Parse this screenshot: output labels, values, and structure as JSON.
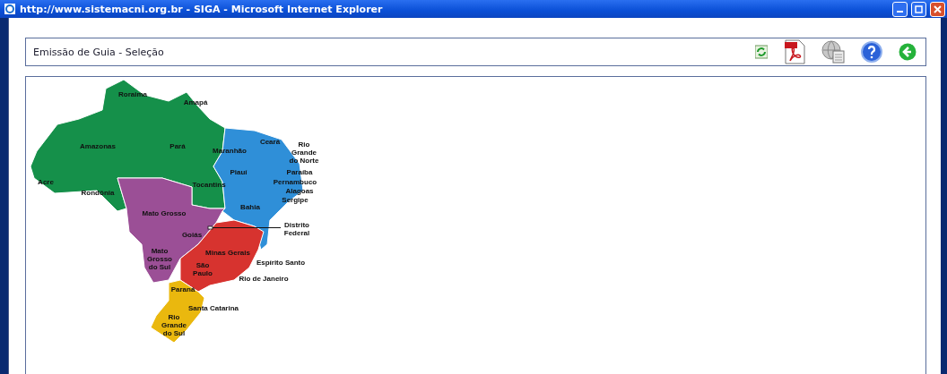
{
  "window": {
    "title": "http://www.sistemacni.org.br - SIGA - Microsoft Internet Explorer"
  },
  "header": {
    "title": "Emissão de Guia - Seleção"
  },
  "map": {
    "regions": [
      {
        "color": "#15904a",
        "states": [
          {
            "name": "Roraima"
          },
          {
            "name": "Amapá"
          },
          {
            "name": "Amazonas"
          },
          {
            "name": "Pará"
          },
          {
            "name": "Acre"
          },
          {
            "name": "Rondônia"
          },
          {
            "name": "Tocantins"
          }
        ]
      },
      {
        "color": "#2f8fd8",
        "states": [
          {
            "name": "Maranhão"
          },
          {
            "name": "Ceará"
          },
          {
            "name": "Rio Grande do Norte"
          },
          {
            "name": "Piauí"
          },
          {
            "name": "Paraíba"
          },
          {
            "name": "Pernambuco"
          },
          {
            "name": "Alagoas"
          },
          {
            "name": "Sergipe"
          },
          {
            "name": "Bahia"
          }
        ]
      },
      {
        "color": "#9b4f96",
        "states": [
          {
            "name": "Mato Grosso"
          },
          {
            "name": "Distrito Federal"
          },
          {
            "name": "Goiás"
          },
          {
            "name": "Mato Grosso do Sul"
          }
        ]
      },
      {
        "color": "#d7332f",
        "states": [
          {
            "name": "Minas Gerais"
          },
          {
            "name": "Espírito Santo"
          },
          {
            "name": "São Paulo"
          },
          {
            "name": "Rio de Janeiro"
          }
        ]
      },
      {
        "color": "#eab80e",
        "states": [
          {
            "name": "Paraná"
          },
          {
            "name": "Santa Catarina"
          },
          {
            "name": "Rio Grande do Sul"
          }
        ]
      }
    ]
  }
}
